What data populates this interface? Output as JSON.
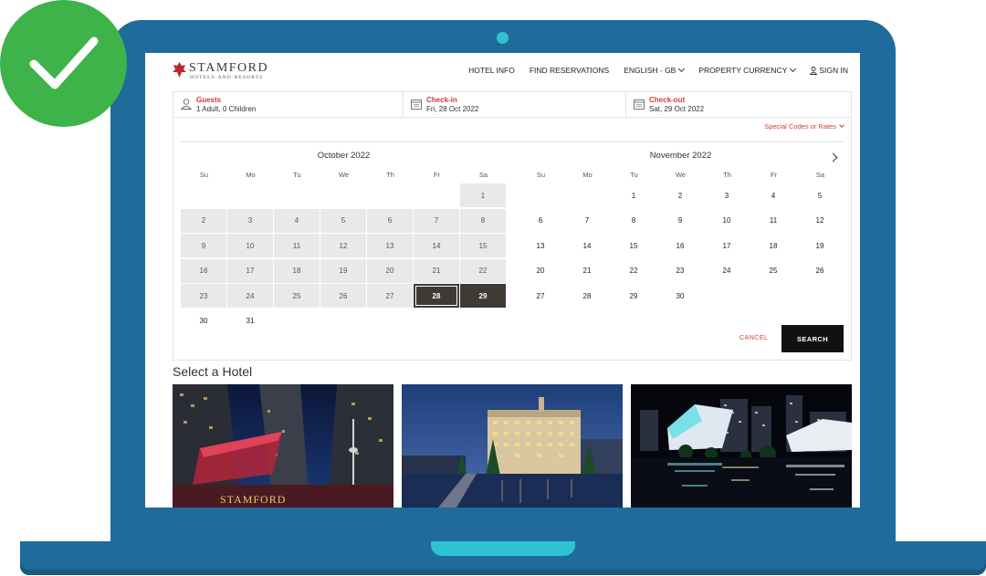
{
  "brand": {
    "logo_main": "STAMFORD",
    "logo_sub": "HOTELS·AND·RESORTS",
    "accent_color": "#d23a3a"
  },
  "nav": {
    "hotel_info": "HOTEL INFO",
    "find_reservations": "FIND RESERVATIONS",
    "language": "ENGLISH - GB",
    "currency": "PROPERTY CURRENCY",
    "sign_in": "SIGN IN"
  },
  "booking": {
    "guests_label": "Guests",
    "guests_value": "1 Adult, 0 Children",
    "checkin_label": "Check-in",
    "checkin_value": "Fri, 28 Oct 2022",
    "checkout_label": "Check-out",
    "checkout_value": "Sat, 29 Oct 2022",
    "special_codes": "Special Codes or Rates",
    "cancel": "CANCEL",
    "search": "SEARCH"
  },
  "calendar": {
    "weekdays": [
      "Su",
      "Mo",
      "Tu",
      "We",
      "Th",
      "Fr",
      "Sa"
    ],
    "months": [
      {
        "title": "October 2022",
        "first_weekday": 6,
        "days": 31,
        "shaded_until": 27,
        "selected": [
          28,
          29
        ]
      },
      {
        "title": "November 2022",
        "first_weekday": 2,
        "days": 30,
        "shaded_until": 0,
        "selected": []
      }
    ]
  },
  "hotels": {
    "section_title": "Select a Hotel",
    "sign_text": "STAMFORD"
  },
  "icons": [
    "check-icon",
    "user-icon",
    "calendar-icon",
    "chevron-down-icon",
    "chevron-right-icon"
  ]
}
